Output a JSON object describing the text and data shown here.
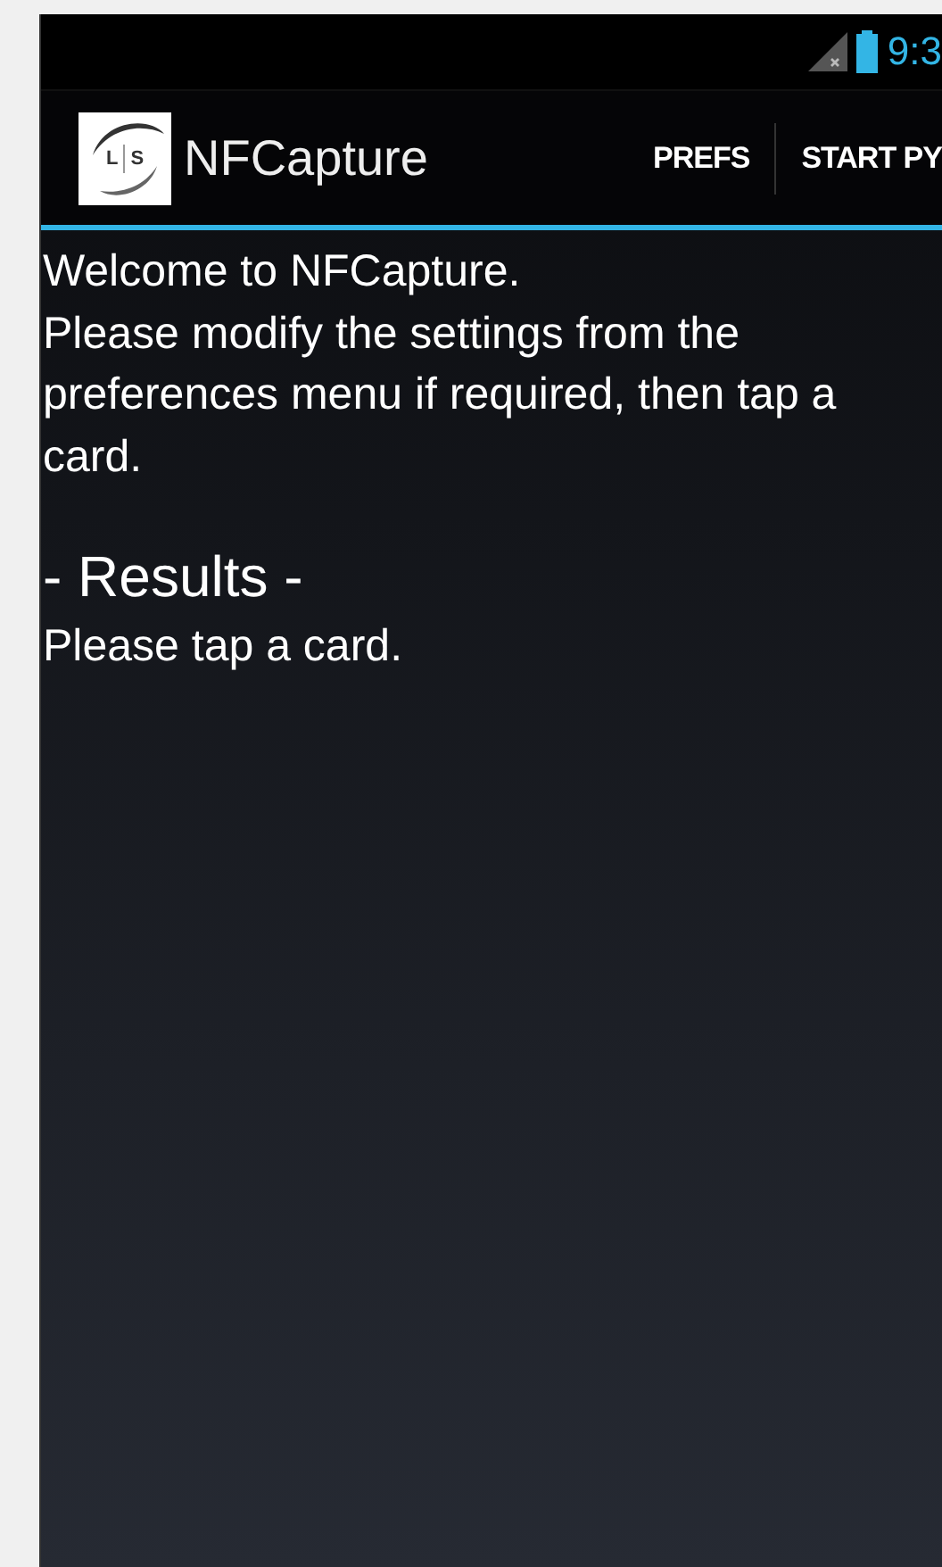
{
  "status_bar": {
    "time": "9:3"
  },
  "action_bar": {
    "logo_letters": [
      "L",
      "S"
    ],
    "title": "NFCapture",
    "actions": [
      {
        "label": "PREFS"
      },
      {
        "label": "START PY"
      }
    ]
  },
  "content": {
    "welcome": "Welcome to NFCapture.",
    "instructions": "Please modify the settings from the preferences menu if required, then tap a card.",
    "results_heading": "- Results -",
    "results_text": "Please tap a card."
  }
}
